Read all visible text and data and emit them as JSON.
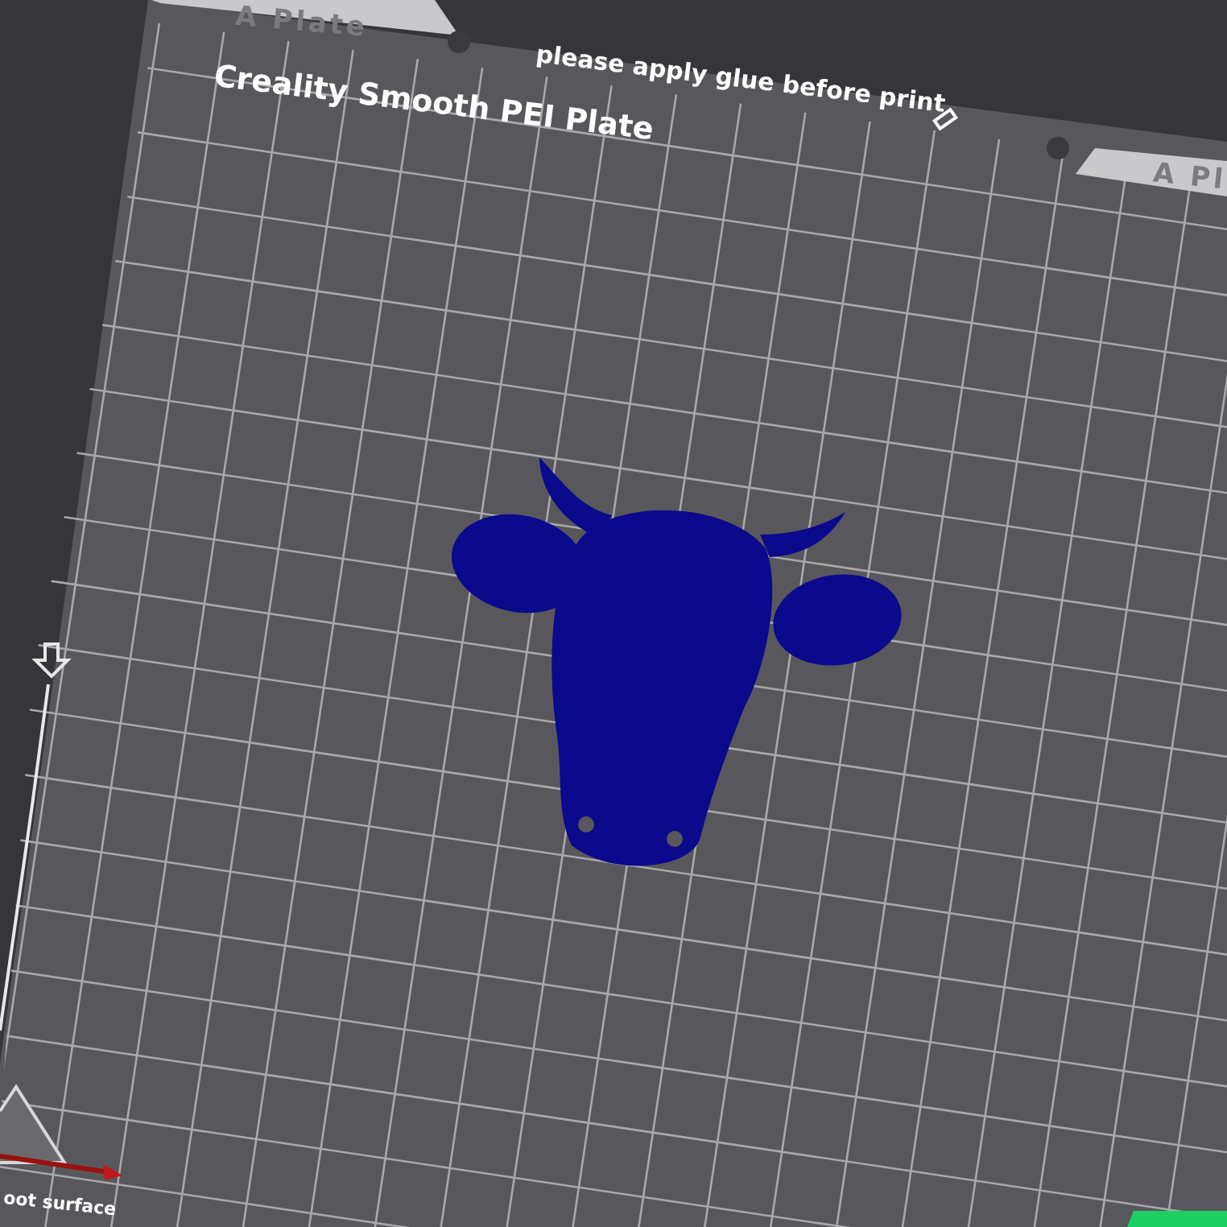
{
  "plate_tabs": [
    {
      "label": "A Plate"
    },
    {
      "label": "A Pl"
    }
  ],
  "notice": "please apply glue before print",
  "plate_name": "Creality Smooth PEI Plate",
  "bottom_label": "oot surface"
}
